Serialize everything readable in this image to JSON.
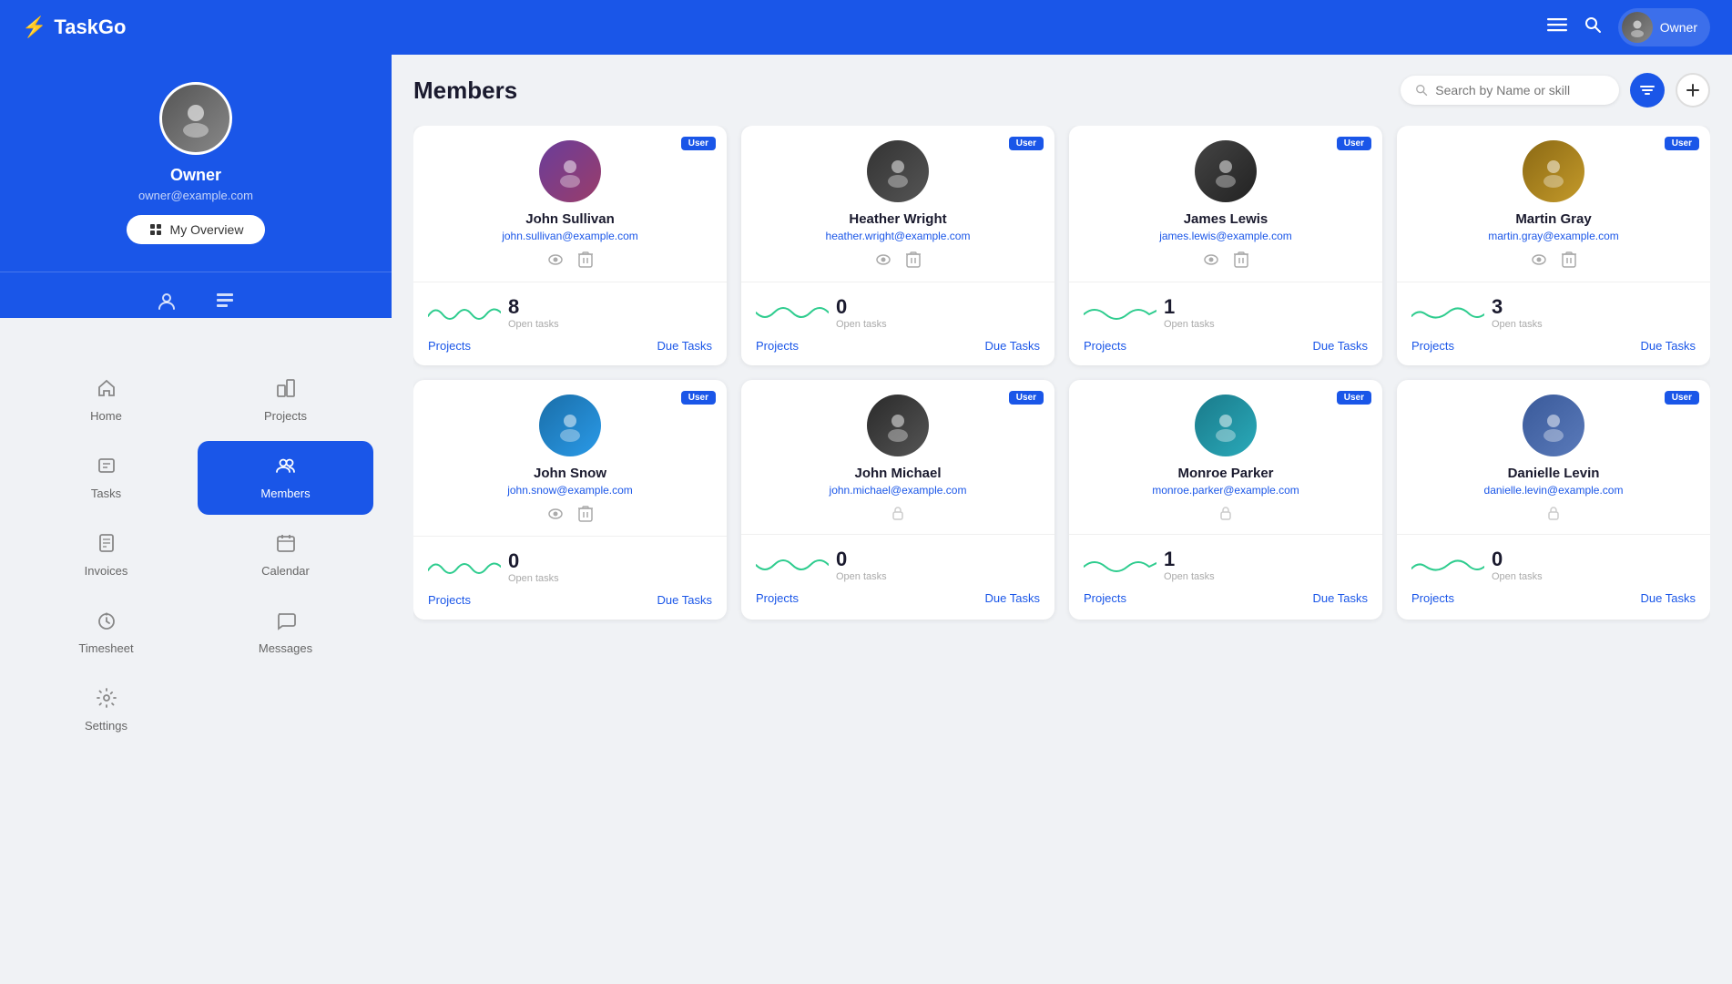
{
  "app": {
    "name": "TaskGo",
    "logo_icon": "⚡"
  },
  "topnav": {
    "menu_icon": "≡",
    "search_icon": "🔍",
    "owner_label": "Owner"
  },
  "sidebar": {
    "profile": {
      "name": "Owner",
      "email": "owner@example.com",
      "overview_btn": "My Overview"
    },
    "nav_items": [
      {
        "id": "home",
        "icon": "🏠",
        "label": "Home",
        "active": false
      },
      {
        "id": "projects",
        "icon": "🔧",
        "label": "Projects",
        "active": false
      },
      {
        "id": "tasks",
        "icon": "☰",
        "label": "Tasks",
        "active": false
      },
      {
        "id": "members",
        "icon": "👥",
        "label": "Members",
        "active": true
      },
      {
        "id": "invoices",
        "icon": "📋",
        "label": "Invoices",
        "active": false
      },
      {
        "id": "calendar",
        "icon": "📅",
        "label": "Calendar",
        "active": false
      },
      {
        "id": "timesheet",
        "icon": "⏱",
        "label": "Timesheet",
        "active": false
      },
      {
        "id": "messages",
        "icon": "💬",
        "label": "Messages",
        "active": false
      },
      {
        "id": "settings",
        "icon": "⚙",
        "label": "Settings",
        "active": false
      }
    ]
  },
  "members_page": {
    "title": "Members",
    "search_placeholder": "Search by Name or skill",
    "filter_icon": "filter",
    "add_icon": "+",
    "cards": [
      {
        "id": "john-sullivan",
        "badge": "User",
        "name": "John Sullivan",
        "email": "john.sullivan@example.com",
        "open_tasks": 8,
        "tasks_label": "Open tasks",
        "projects_label": "Projects",
        "due_tasks_label": "Due Tasks",
        "has_view": true,
        "has_delete": true,
        "avatar_class": "av-1"
      },
      {
        "id": "heather-wright",
        "badge": "User",
        "name": "Heather Wright",
        "email": "heather.wright@example.com",
        "open_tasks": 0,
        "tasks_label": "Open tasks",
        "projects_label": "Projects",
        "due_tasks_label": "Due Tasks",
        "has_view": true,
        "has_delete": true,
        "avatar_class": "av-2"
      },
      {
        "id": "james-lewis",
        "badge": "User",
        "name": "James Lewis",
        "email": "james.lewis@example.com",
        "open_tasks": 1,
        "tasks_label": "Open tasks",
        "projects_label": "Projects",
        "due_tasks_label": "Due Tasks",
        "has_view": true,
        "has_delete": true,
        "avatar_class": "av-3"
      },
      {
        "id": "martin-gray",
        "badge": "User",
        "name": "Martin Gray",
        "email": "martin.gray@example.com",
        "open_tasks": 3,
        "tasks_label": "Open tasks",
        "projects_label": "Projects",
        "due_tasks_label": "Due Tasks",
        "has_view": true,
        "has_delete": true,
        "avatar_class": "av-4"
      },
      {
        "id": "john-snow",
        "badge": "User",
        "name": "John Snow",
        "email": "john.snow@example.com",
        "open_tasks": 0,
        "tasks_label": "Open tasks",
        "projects_label": "Projects",
        "due_tasks_label": "Due Tasks",
        "has_view": true,
        "has_delete": true,
        "avatar_class": "av-5"
      },
      {
        "id": "john-michael",
        "badge": "User",
        "name": "John Michael",
        "email": "john.michael@example.com",
        "open_tasks": 0,
        "tasks_label": "Open tasks",
        "projects_label": "Projects",
        "due_tasks_label": "Due Tasks",
        "has_view": false,
        "has_delete": false,
        "locked": true,
        "avatar_class": "av-6"
      },
      {
        "id": "monroe-parker",
        "badge": "User",
        "name": "Monroe Parker",
        "email": "monroe.parker@example.com",
        "open_tasks": 1,
        "tasks_label": "Open tasks",
        "projects_label": "Projects",
        "due_tasks_label": "Due Tasks",
        "has_view": false,
        "has_delete": false,
        "locked": true,
        "avatar_class": "av-7"
      },
      {
        "id": "danielle-levin",
        "badge": "User",
        "name": "Danielle Levin",
        "email": "danielle.levin@example.com",
        "open_tasks": 0,
        "tasks_label": "Open tasks",
        "projects_label": "Projects",
        "due_tasks_label": "Due Tasks",
        "has_view": false,
        "has_delete": false,
        "locked": true,
        "avatar_class": "av-8"
      }
    ]
  }
}
